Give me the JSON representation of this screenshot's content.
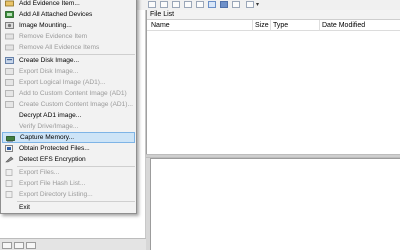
{
  "menu": {
    "items": [
      {
        "label": "Add Evidence Item...",
        "disabled": false,
        "icon": "evidence-item-icon"
      },
      {
        "label": "Add All Attached Devices",
        "disabled": false,
        "icon": "attached-devices-icon"
      },
      {
        "label": "Image Mounting...",
        "disabled": false,
        "icon": "image-mounting-icon"
      },
      {
        "label": "Remove Evidence Item",
        "disabled": true,
        "icon": "remove-evidence-icon"
      },
      {
        "label": "Remove All Evidence Items",
        "disabled": true,
        "icon": "remove-all-evidence-icon"
      },
      {
        "label": "Create Disk Image...",
        "disabled": false,
        "icon": "create-disk-image-icon"
      },
      {
        "label": "Export Disk Image...",
        "disabled": true,
        "icon": "export-disk-image-icon"
      },
      {
        "label": "Export Logical Image (AD1)...",
        "disabled": true,
        "icon": "export-logical-image-icon"
      },
      {
        "label": "Add to Custom Content Image (AD1)",
        "disabled": true,
        "icon": "add-custom-content-icon"
      },
      {
        "label": "Create Custom Content Image (AD1)...",
        "disabled": true,
        "icon": "create-custom-content-icon"
      },
      {
        "label": "Decrypt AD1 image...",
        "disabled": false,
        "icon": "decrypt-icon"
      },
      {
        "label": "Verify Drive/Image...",
        "disabled": true,
        "icon": "verify-icon"
      },
      {
        "label": "Capture Memory...",
        "disabled": false,
        "icon": "capture-memory-icon"
      },
      {
        "label": "Obtain Protected Files...",
        "disabled": false,
        "icon": "protected-files-icon"
      },
      {
        "label": "Detect EFS Encryption",
        "disabled": false,
        "icon": "efs-encryption-icon"
      },
      {
        "label": "Export Files...",
        "disabled": true,
        "icon": "export-files-icon"
      },
      {
        "label": "Export File Hash List...",
        "disabled": true,
        "icon": "export-hash-list-icon"
      },
      {
        "label": "Export Directory Listing...",
        "disabled": true,
        "icon": "export-directory-icon"
      },
      {
        "label": "Exit",
        "disabled": false,
        "icon": ""
      }
    ],
    "highlighted_index": 12
  },
  "file_list": {
    "title": "File List",
    "columns": [
      "Name",
      "Size",
      "Type",
      "Date Modified"
    ]
  },
  "colors": {
    "menu_bg": "#f2f2f2",
    "highlight_bg": "#cde4f7",
    "highlight_border": "#7eb4e6",
    "disabled_text": "#9a9a9a"
  }
}
